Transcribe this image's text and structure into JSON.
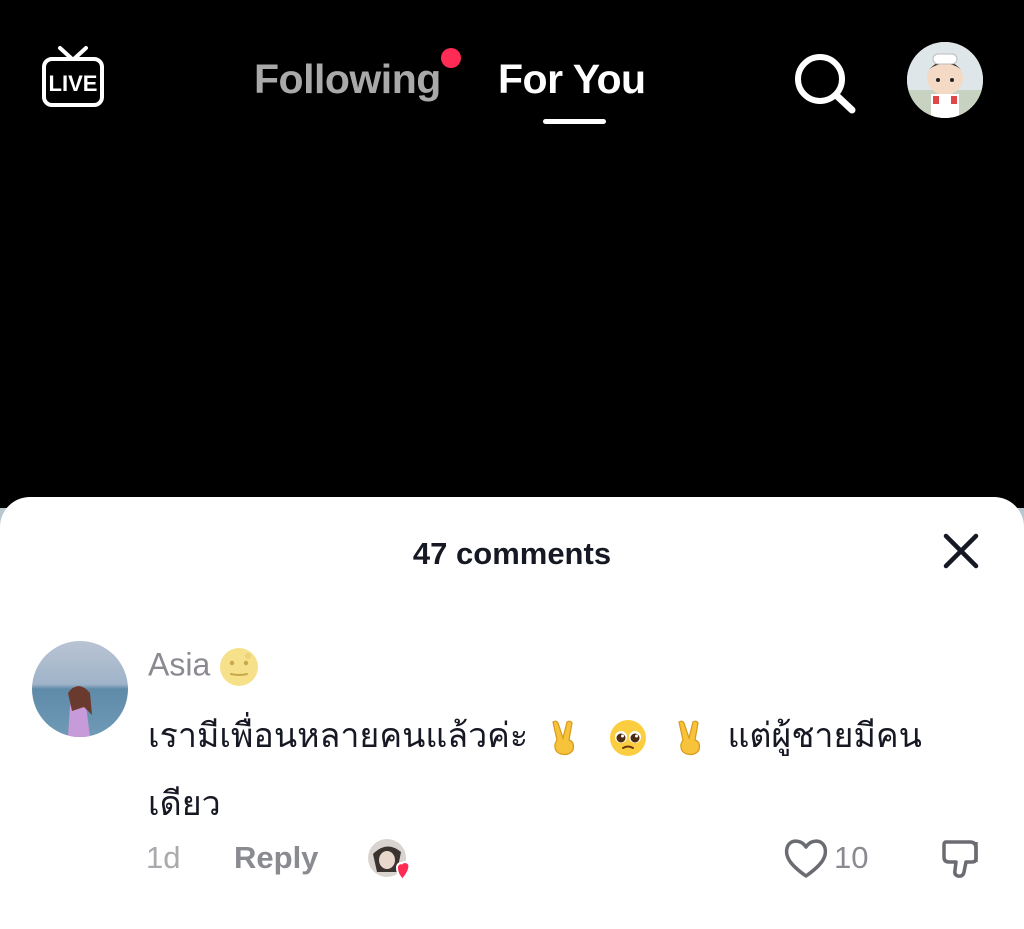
{
  "header": {
    "live_label": "LIVE",
    "tabs": [
      {
        "label": "Following",
        "active": false,
        "has_notification": true
      },
      {
        "label": "For You",
        "active": true
      }
    ]
  },
  "comments_sheet": {
    "title": "47 comments",
    "comments": [
      {
        "username": "Asia",
        "username_emoji": "moon-face-emoji",
        "text_part1": "เรามีเพื่อนหลายคนแล้วค่ะ",
        "text_emojis": [
          "victory-hand-emoji",
          "pleading-face-emoji",
          "victory-hand-emoji"
        ],
        "text_part2": "แต่ผู้ชายมีคน",
        "text_part3": "เดียว",
        "time": "1d",
        "reply_label": "Reply",
        "like_count": "10"
      }
    ]
  },
  "colors": {
    "accent": "#fe2c55",
    "inactive_tab": "#a9a9a9",
    "muted_text": "#8a8b91"
  }
}
